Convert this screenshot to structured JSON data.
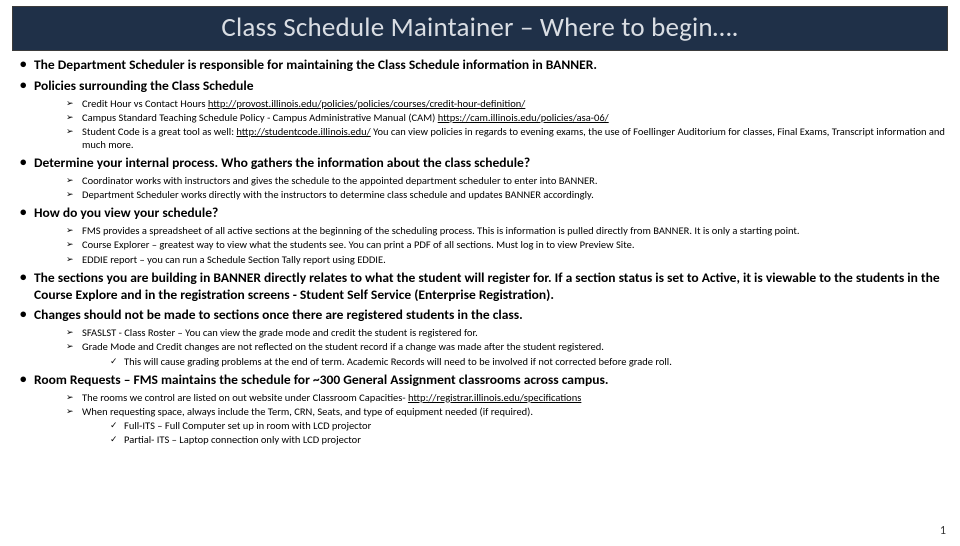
{
  "title": "Class Schedule Maintainer – Where to begin….",
  "page_number": "1",
  "b1": "The Department Scheduler is responsible for maintaining the Class Schedule information in BANNER.",
  "b2": "Policies surrounding the Class Schedule",
  "b2s1a": "Credit Hour vs Contact Hours ",
  "b2s1link": "http://provost.illinois.edu/policies/policies/courses/credit-hour-definition/",
  "b2s2a": "Campus Standard Teaching Schedule Policy - Campus Administrative Manual (CAM) ",
  "b2s2link": "https://cam.illinois.edu/policies/asa-06/",
  "b2s3a": "Student Code is a great tool as well: ",
  "b2s3link": "http://studentcode.illinois.edu/",
  "b2s3b": "  You can view policies in regards to evening exams, the use of Foellinger Auditorium for classes, Final Exams, Transcript information and much more.",
  "b3": "Determine your internal process. Who gathers the information about the class schedule?",
  "b3s1": "Coordinator works with instructors and gives the schedule to the appointed department scheduler to enter into BANNER.",
  "b3s2": "Department Scheduler works directly with the instructors to determine class schedule and updates BANNER accordingly.",
  "b4": "How do you view your schedule?",
  "b4s1": "FMS provides a spreadsheet of all active sections at the beginning of the scheduling process. This is information is pulled directly from BANNER. It is only a starting point.",
  "b4s2": "Course Explorer – greatest way to view what the students see. You can print a PDF of all sections. Must log in to view Preview Site.",
  "b4s3": "EDDIE report – you can run a Schedule Section Tally report using EDDIE.",
  "b5": "The sections you are building in BANNER directly relates to what the student will register for. If a section status is set to Active, it is viewable to the students in the Course Explore and in the registration screens - Student Self Service (Enterprise Registration).",
  "b6": "Changes should not be made to sections once there are registered students in the class.",
  "b6s1": "SFASLST  - Class Roster – You can view the grade mode and credit the student is registered for.",
  "b6s2": "Grade Mode and Credit changes are not reflected on the student record if a change was made after the student registered.",
  "b6s2c1": "This will cause grading problems at the end of term. Academic Records will need to be involved if not corrected before grade roll.",
  "b7": "Room Requests – FMS maintains the schedule for ~300 General Assignment classrooms across campus.",
  "b7s1a": "The rooms we control are listed on out website under Classroom Capacities- ",
  "b7s1link": "http://registrar.illinois.edu/specifications",
  "b7s2": "When requesting space, always include the Term, CRN, Seats, and type of equipment needed (if required).",
  "b7s2c1": "Full-ITS – Full Computer set up in room with LCD projector",
  "b7s2c2": "Partial- ITS – Laptop connection only with LCD projector"
}
